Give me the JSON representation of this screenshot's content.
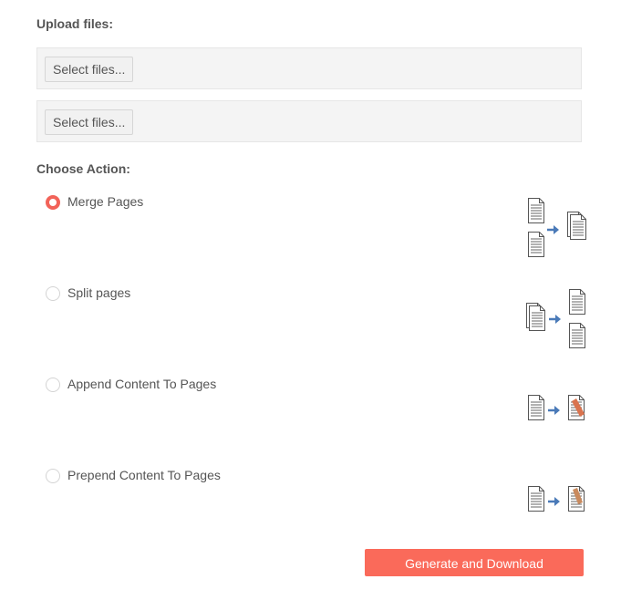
{
  "upload": {
    "title": "Upload files:",
    "slots": [
      {
        "button_label": "Select files..."
      },
      {
        "button_label": "Select files..."
      }
    ]
  },
  "actions": {
    "title": "Choose Action:",
    "options": [
      {
        "label": "Merge Pages",
        "selected": true,
        "icon": "merge-pages-icon"
      },
      {
        "label": "Split pages",
        "selected": false,
        "icon": "split-pages-icon"
      },
      {
        "label": "Append Content To Pages",
        "selected": false,
        "icon": "append-content-icon"
      },
      {
        "label": "Prepend Content To Pages",
        "selected": false,
        "icon": "prepend-content-icon"
      }
    ]
  },
  "submit": {
    "label": "Generate and Download"
  },
  "colors": {
    "accent": "#fa6a5a",
    "radio_selected": "#f26359",
    "arrow": "#4a7ab8"
  }
}
